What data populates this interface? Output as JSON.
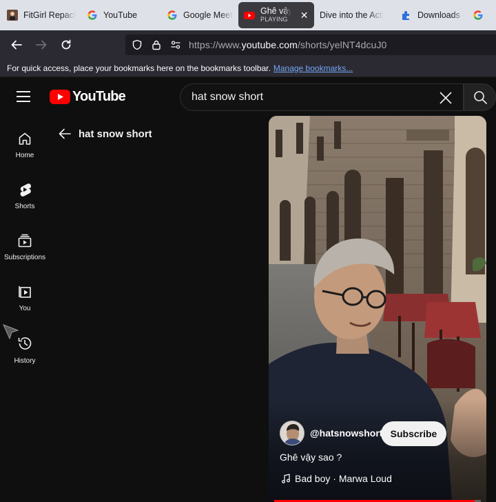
{
  "browser": {
    "tabs": [
      {
        "title": "FitGirl Repack",
        "icon": "fitgirl-favicon"
      },
      {
        "title": "YouTube",
        "icon": "google-favicon"
      },
      {
        "title": "Google Meet",
        "icon": "google-favicon"
      },
      {
        "title": "Ghê vậy sao",
        "subtitle": "PLAYING",
        "icon": "youtube-favicon",
        "active": true
      },
      {
        "title": "Dive into the Acti",
        "icon": "none"
      },
      {
        "title": "Downloads -",
        "icon": "puzzle-favicon"
      },
      {
        "title": "G",
        "icon": "google-favicon"
      }
    ],
    "url_prefix": "https://www.",
    "url_domain": "youtube.com",
    "url_path": "/shorts/yelNT4dcuJ0",
    "bookmarks_message": "For quick access, place your bookmarks here on the bookmarks toolbar.",
    "bookmarks_link": "Manage bookmarks..."
  },
  "youtube": {
    "logo_text": "YouTube",
    "search_query": "hat snow short",
    "guide": [
      {
        "label": "Home",
        "icon": "home-icon"
      },
      {
        "label": "Shorts",
        "icon": "shorts-icon"
      },
      {
        "label": "Subscriptions",
        "icon": "subscriptions-icon"
      },
      {
        "label": "You",
        "icon": "you-icon"
      },
      {
        "label": "History",
        "icon": "history-icon"
      }
    ],
    "back_title": "hat snow short",
    "short": {
      "channel_handle": "@hatsnowshort",
      "subscribe_label": "Subscribe",
      "caption": "Ghê vậy sao ?",
      "music": "Bad boy · Marwa Loud",
      "progress": 0.97
    }
  },
  "colors": {
    "youtube_red": "#ff0000",
    "link_blue": "#73a7f3",
    "page_bg": "#0f0f0f"
  }
}
